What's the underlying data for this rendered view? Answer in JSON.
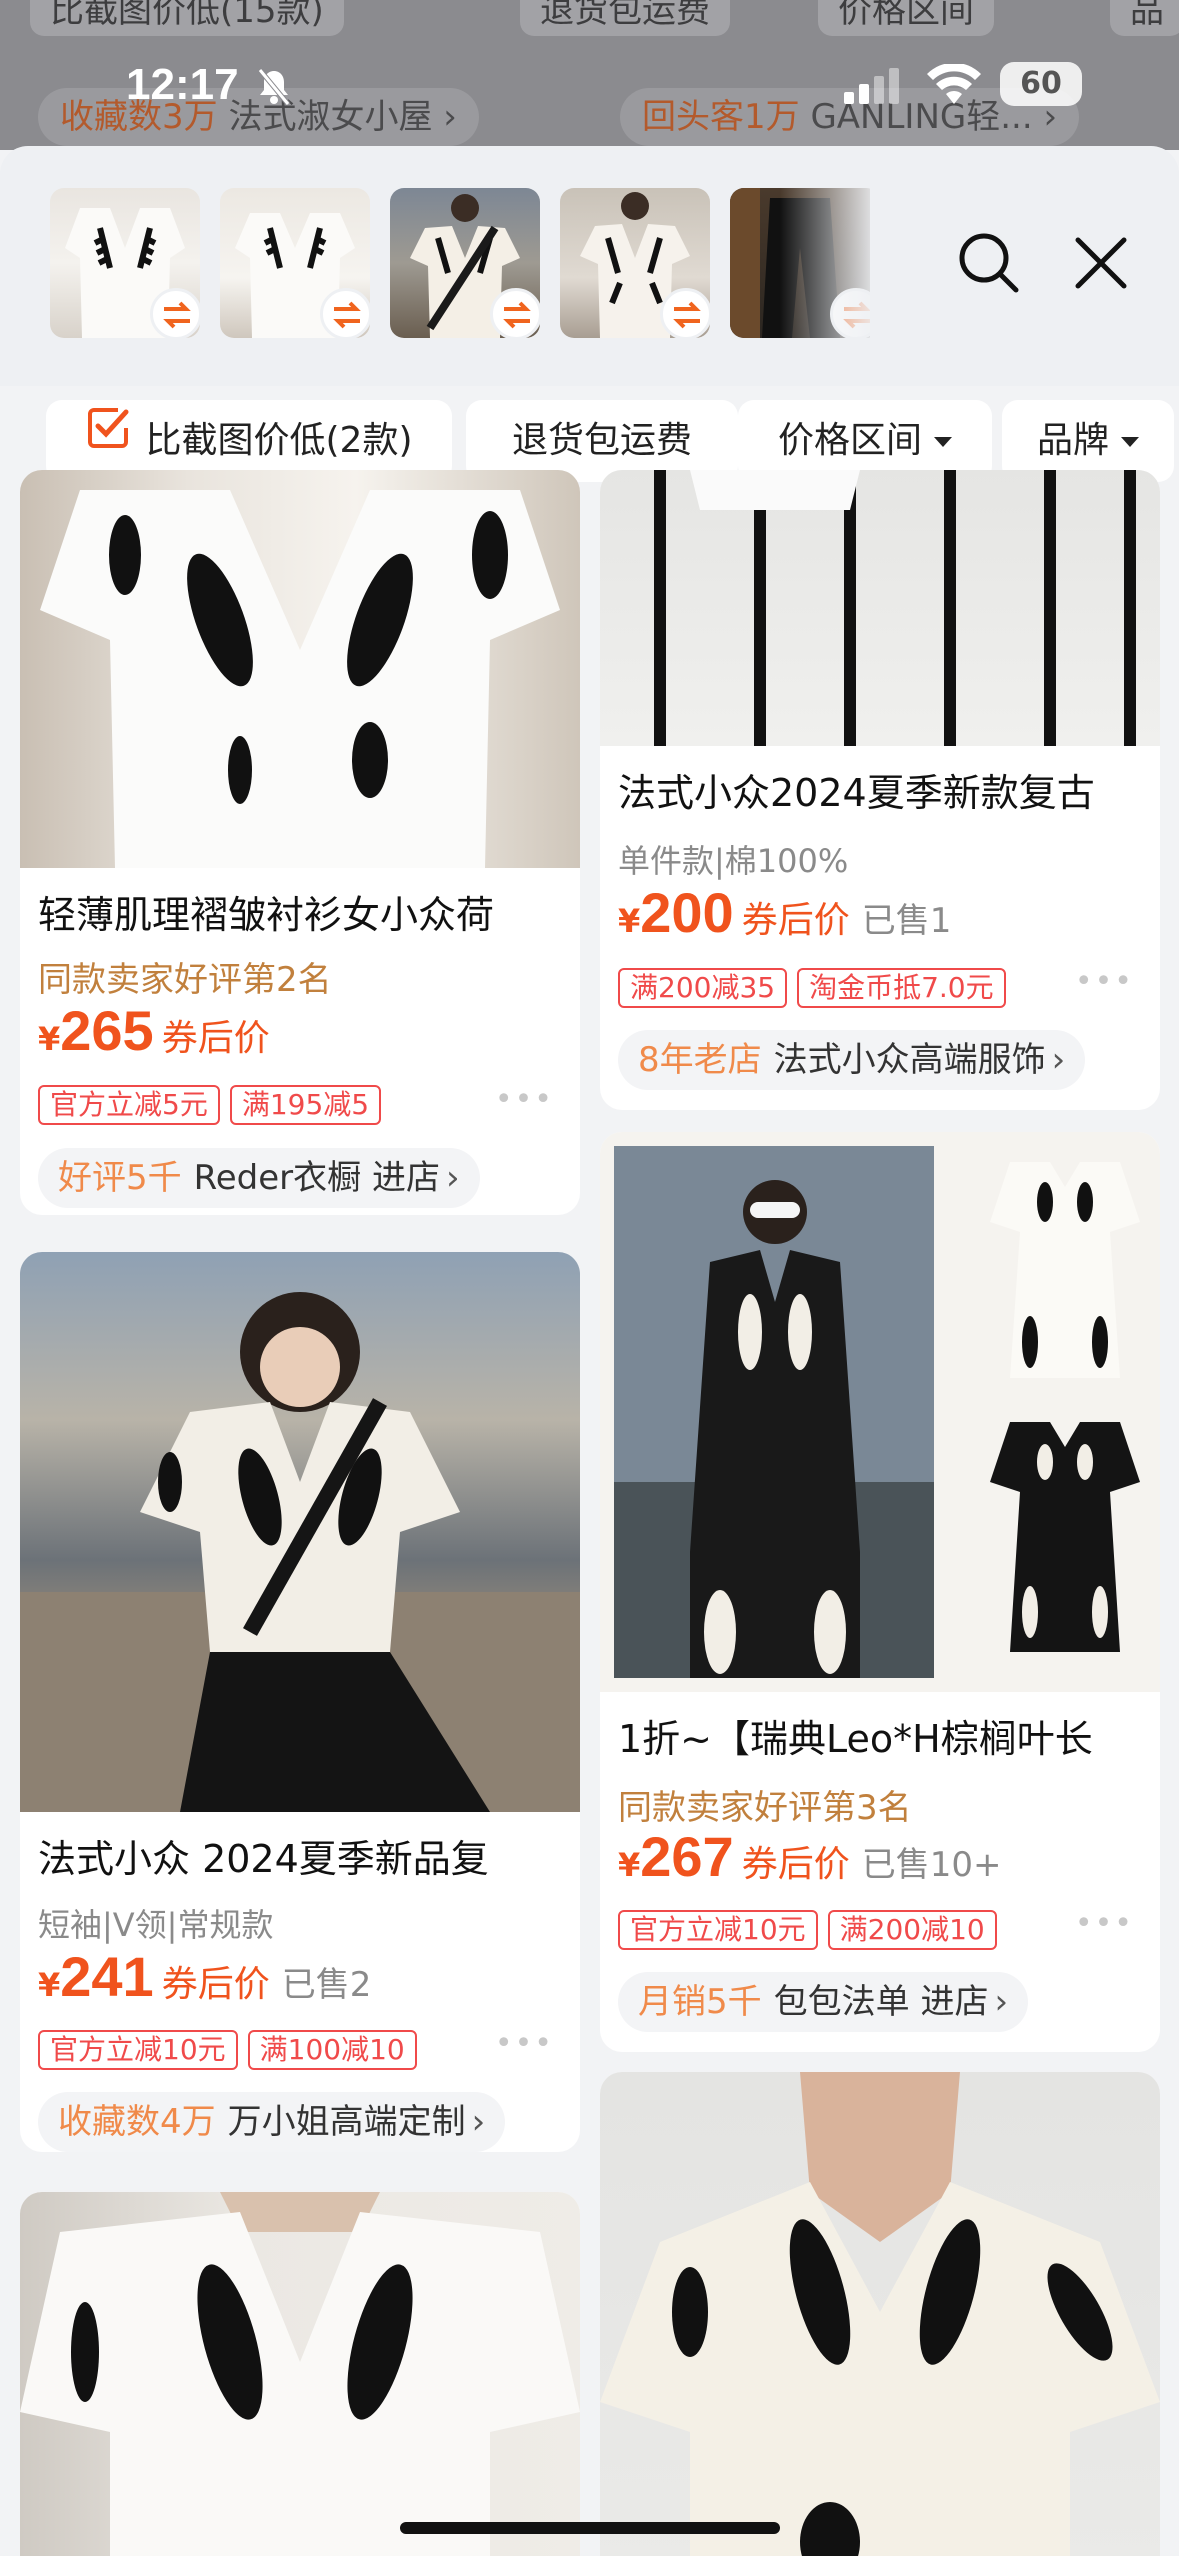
{
  "backdrop": {
    "chips": [
      "比截图价低(15款)",
      "退货包运费",
      "价格区间",
      "品"
    ],
    "shops": [
      {
        "highlight": "收藏数3万",
        "name": "法式淑女小屋"
      },
      {
        "highlight": "回头客1万",
        "name": "GANLING轻..."
      }
    ]
  },
  "status_bar": {
    "time": "12:17",
    "battery": "60"
  },
  "header": {
    "thumbnails": [
      "thumbnail-1",
      "thumbnail-2",
      "thumbnail-3",
      "thumbnail-4",
      "thumbnail-5"
    ]
  },
  "filters": [
    {
      "label": "比截图价低(2款)",
      "checked": true
    },
    {
      "label": "退货包运费"
    },
    {
      "label": "价格区间",
      "dropdown": true
    },
    {
      "label": "品牌",
      "dropdown": true
    }
  ],
  "products": {
    "p1": {
      "title": "轻薄肌理褶皱衬衫女小众荷",
      "rank": "同款卖家好评第2名",
      "currency": "¥",
      "price": "265",
      "price_suffix": "券后价",
      "tags": [
        "官方立减5元",
        "满195减5"
      ],
      "more": "•••",
      "shop_highlight": "好评5千",
      "shop_name": "Reder衣橱 进店"
    },
    "p2": {
      "title": "法式小众2024夏季新款复古",
      "sub": "单件款|棉100%",
      "currency": "¥",
      "price": "200",
      "price_suffix": "券后价",
      "sold": "已售1",
      "tags": [
        "满200减35",
        "淘金币抵7.0元"
      ],
      "more": "•••",
      "shop_highlight": "8年老店",
      "shop_name": "法式小众高端服饰"
    },
    "p3": {
      "title": "法式小众 2024夏季新品复",
      "sub": "短袖|V领|常规款",
      "currency": "¥",
      "price": "241",
      "price_suffix": "券后价",
      "sold": "已售2",
      "tags": [
        "官方立减10元",
        "满100减10"
      ],
      "more": "•••",
      "shop_highlight": "收藏数4万",
      "shop_name": "万小姐高端定制"
    },
    "p4": {
      "title": "1折~【瑞典Leo*H棕榈叶长",
      "rank": "同款卖家好评第3名",
      "currency": "¥",
      "price": "267",
      "price_suffix": "券后价",
      "sold": "已售10+",
      "tags": [
        "官方立减10元",
        "满200减10"
      ],
      "more": "•••",
      "shop_highlight": "月销5千",
      "shop_name": "包包法单 进店"
    }
  },
  "colors": {
    "accent": "#f0531d",
    "tag_red": "#f04a4a",
    "shop_highlight": "#f08a4a"
  }
}
